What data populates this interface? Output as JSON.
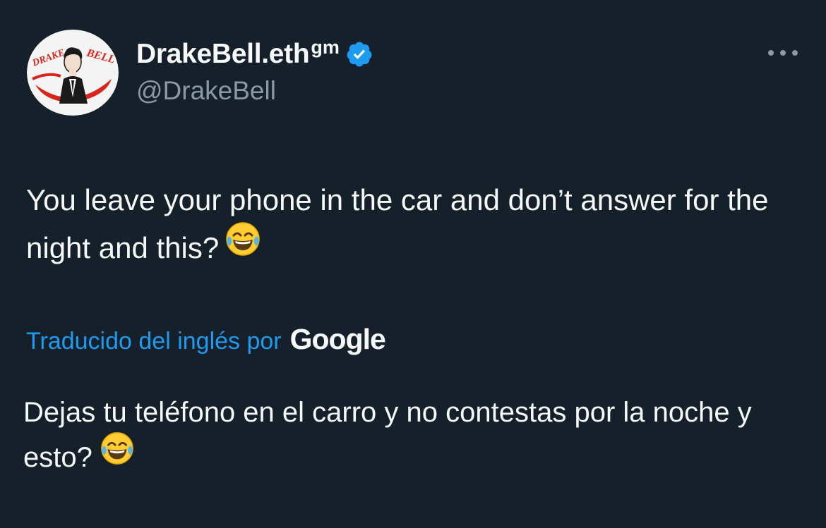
{
  "author": {
    "display_name": "DrakeBell.eth",
    "name_suffix": "gm",
    "handle": "@DrakeBell",
    "verified": true,
    "avatar_text_left": "DRAKE",
    "avatar_text_right": "BELL",
    "avatar_icon": "avatar-logo"
  },
  "tweet": {
    "text": "You leave your phone in the car and don’t answer for the night and this?",
    "emoji_icon": "face-with-tears-of-joy-icon"
  },
  "translation": {
    "label": "Traducido del inglés por",
    "provider": "Google",
    "text": "Dejas tu teléfono en el carro y no contestas por la noche y esto?",
    "emoji_icon": "face-with-tears-of-joy-icon"
  },
  "icons": {
    "more": "more-options-icon",
    "verified": "verified-badge-icon"
  },
  "colors": {
    "background": "#15202b",
    "primary_text": "#f7f9f9",
    "secondary_text": "#8b98a5",
    "accent": "#1d9bf0"
  }
}
